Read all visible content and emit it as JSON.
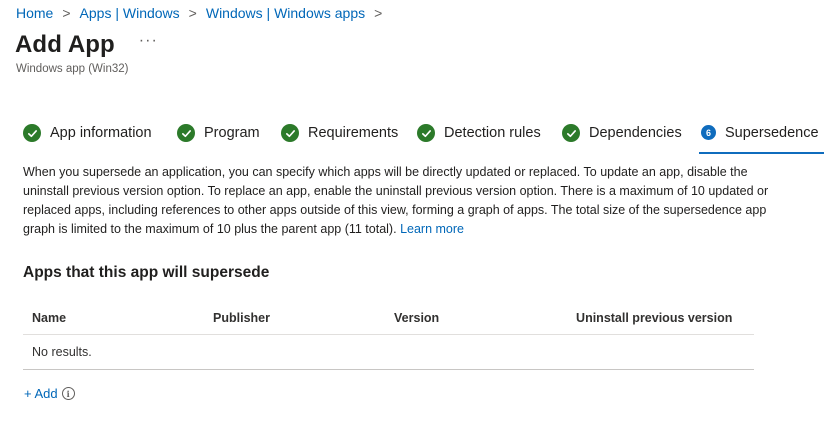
{
  "breadcrumb": {
    "items": [
      "Home",
      "Apps | Windows",
      "Windows | Windows apps"
    ],
    "separator": ">"
  },
  "header": {
    "title": "Add App",
    "more": "···",
    "subtitle": "Windows app (Win32)"
  },
  "tabs": [
    {
      "label": "App information",
      "status": "complete"
    },
    {
      "label": "Program",
      "status": "complete"
    },
    {
      "label": "Requirements",
      "status": "complete"
    },
    {
      "label": "Detection rules",
      "status": "complete"
    },
    {
      "label": "Dependencies",
      "status": "complete"
    },
    {
      "label": "Supersedence",
      "status": "active",
      "step": "6"
    }
  ],
  "description": {
    "text": "When you supersede an application, you can specify which apps will be directly updated or replaced. To update an app, disable the uninstall previous version option. To replace an app, enable the uninstall previous version option. There is a maximum of 10 updated or replaced apps, including references to other apps outside of this view, forming a graph of apps. The total size of the supersedence app graph is limited to the maximum of 10 plus the parent app (11 total).",
    "link": "Learn more"
  },
  "section": {
    "title": "Apps that this app will supersede"
  },
  "table": {
    "columns": [
      "Name",
      "Publisher",
      "Version",
      "Uninstall previous version"
    ],
    "empty_text": "No results."
  },
  "add": {
    "label": "+ Add",
    "info_glyph": "i"
  },
  "colors": {
    "link": "#0067b8",
    "check_green": "#2c7a2a",
    "active_blue": "#0f6cbd"
  }
}
